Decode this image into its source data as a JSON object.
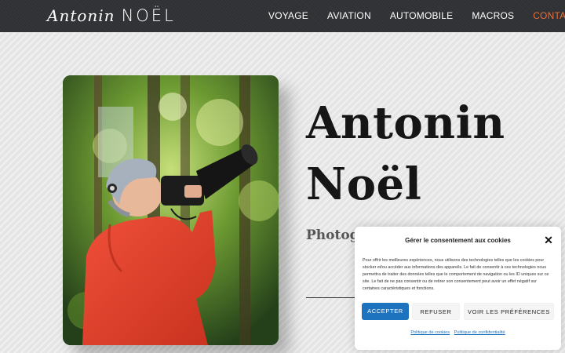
{
  "header": {
    "logo_first": "Antonin",
    "logo_last": "NOËL",
    "nav": [
      {
        "label": "VOYAGE"
      },
      {
        "label": "AVIATION"
      },
      {
        "label": "AUTOMOBILE"
      },
      {
        "label": "MACROS"
      },
      {
        "label": "CONTACT",
        "active": true
      }
    ],
    "active_color": "#e8703a"
  },
  "hero": {
    "title_line1": "Antonin",
    "title_line2": "Noël",
    "subtitle": "Photogr"
  },
  "cookie_banner": {
    "title": "Gérer le consentement aux cookies",
    "body": "Pour offrir les meilleures expériences, nous utilisons des technologies telles que les cookies pour stocker et/ou accéder aux informations des appareils. Le fait de consentir à ces technologies nous permettra de traiter des données telles que le comportement de navigation ou les ID uniques sur ce site. Le fait de ne pas consentir ou de retirer son consentement peut avoir un effet négatif sur certaines caractéristiques et fonctions.",
    "accept_label": "ACCEPTER",
    "refuse_label": "REFUSER",
    "prefs_label": "VOIR LES PRÉFÉRENCES",
    "link_cookies": "Politique de cookies",
    "link_privacy": "Politique de confidentialité",
    "accent_color": "#1e73be"
  }
}
